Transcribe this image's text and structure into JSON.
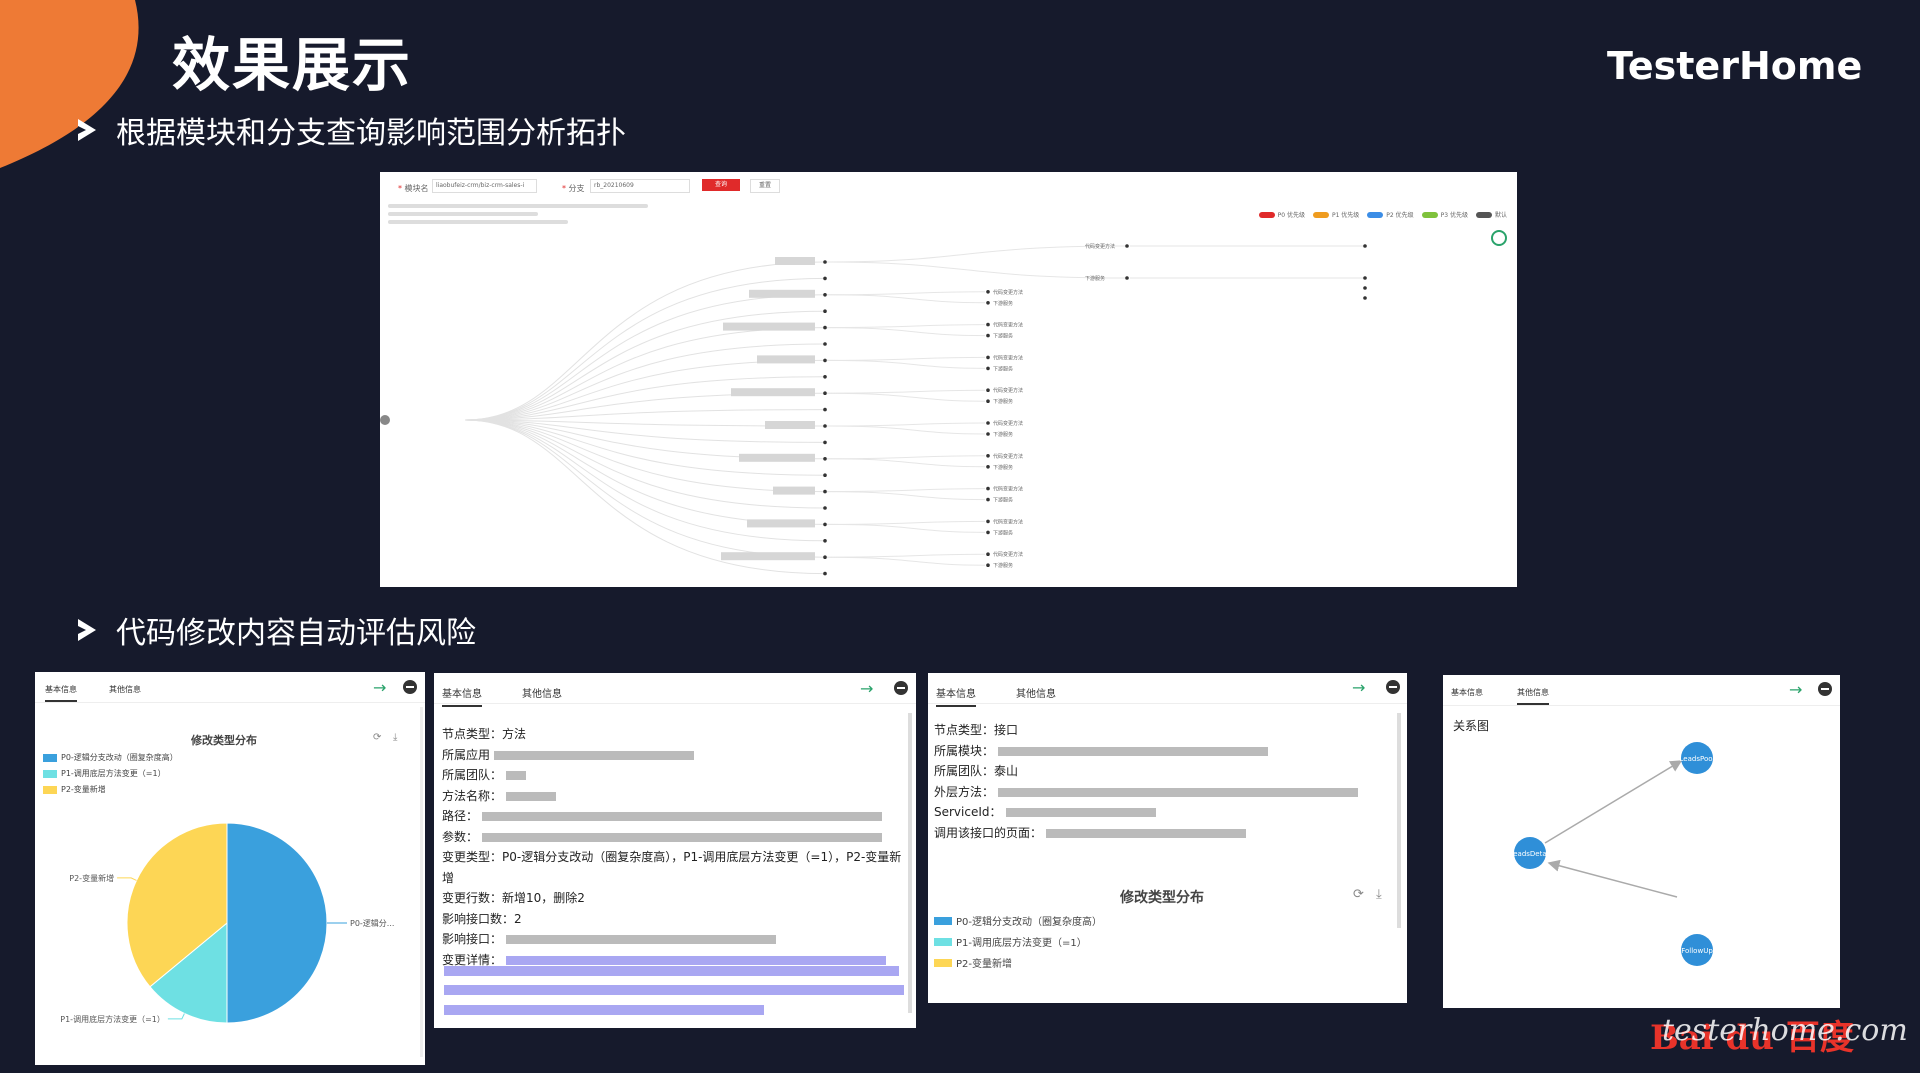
{
  "header": {
    "title": "效果展示",
    "brand": "TesterHome"
  },
  "sections": [
    {
      "text": "根据模块和分支查询影响范围分析拓扑"
    },
    {
      "text": "代码修改内容自动评估风险"
    }
  ],
  "topology": {
    "filters": {
      "module_label": "模块名",
      "module_value": "liaobufeiz-crm/biz-crm-sales-i",
      "branch_label": "分支",
      "branch_value": "rb_20210609",
      "query_btn": "查询",
      "reset_btn": "重置"
    },
    "legend": [
      "P0 优先级",
      "P1 优先级",
      "P2 优先级",
      "P3 优先级",
      "默认"
    ],
    "legend_colors": [
      "#e02a2a",
      "#ef9c1f",
      "#3b8de6",
      "#7fc23c",
      "#555555"
    ],
    "leaf_labels": [
      "代码变更方法",
      "下游服务"
    ]
  },
  "panel1": {
    "tabs": [
      "基本信息",
      "其他信息"
    ],
    "chart_title": "修改类型分布",
    "legend": [
      "P0-逻辑分支改动（圈复杂度高）",
      "P1-调用底层方法变更（=1）",
      "P2-变量新增"
    ],
    "slice_labels": [
      "P0-逻辑分...",
      "P1-调用底层方法变更（=1）",
      "P2-变量新增"
    ]
  },
  "chart_data": {
    "type": "pie",
    "categories": [
      "P0-逻辑分支改动（圈复杂度高）",
      "P1-调用底层方法变更（=1）",
      "P2-变量新增"
    ],
    "values": [
      50,
      14,
      36
    ],
    "colors": [
      "#3aa0dd",
      "#6ee0e3",
      "#fdd655"
    ],
    "title": "修改类型分布"
  },
  "panel2": {
    "tabs": [
      "基本信息",
      "其他信息"
    ],
    "fields": [
      {
        "label": "节点类型：",
        "value": "方法"
      },
      {
        "label": "所属应用",
        "value": ""
      },
      {
        "label": "所属团队：",
        "value": ""
      },
      {
        "label": "方法名称：",
        "value": ""
      },
      {
        "label": "路径：",
        "value": ""
      },
      {
        "label": "参数：",
        "value": ""
      },
      {
        "label": "变更类型：",
        "value": "P0-逻辑分支改动（圈复杂度高），P1-调用底层方法变更（=1），P2-变量新"
      },
      {
        "label": "",
        "value": "增"
      },
      {
        "label": "变更行数：",
        "value": "新增10，删除2"
      },
      {
        "label": "影响接口数：",
        "value": "2"
      },
      {
        "label": "影响接口：",
        "value": ""
      },
      {
        "label": "变更详情：",
        "value": ""
      }
    ]
  },
  "panel3": {
    "tabs": [
      "基本信息",
      "其他信息"
    ],
    "fields": [
      {
        "label": "节点类型：",
        "value": "接口"
      },
      {
        "label": "所属模块：",
        "value": ""
      },
      {
        "label": "所属团队：",
        "value": "泰山"
      },
      {
        "label": "外层方法：",
        "value": ""
      },
      {
        "label": "ServiceId：",
        "value": ""
      },
      {
        "label": "调用该接口的页面：",
        "value": ""
      }
    ],
    "chart_title": "修改类型分布",
    "legend": [
      "P0-逻辑分支改动（圈复杂度高）",
      "P1-调用底层方法变更（=1）",
      "P2-变量新增"
    ]
  },
  "panel4": {
    "tabs": [
      "基本信息",
      "其他信息"
    ],
    "title": "关系图",
    "nodes": [
      "LeadsPool",
      "LeadsDetail",
      "FollowUp"
    ]
  },
  "watermark": {
    "site": "testerhome.com",
    "logo": "Bai du 百度"
  }
}
